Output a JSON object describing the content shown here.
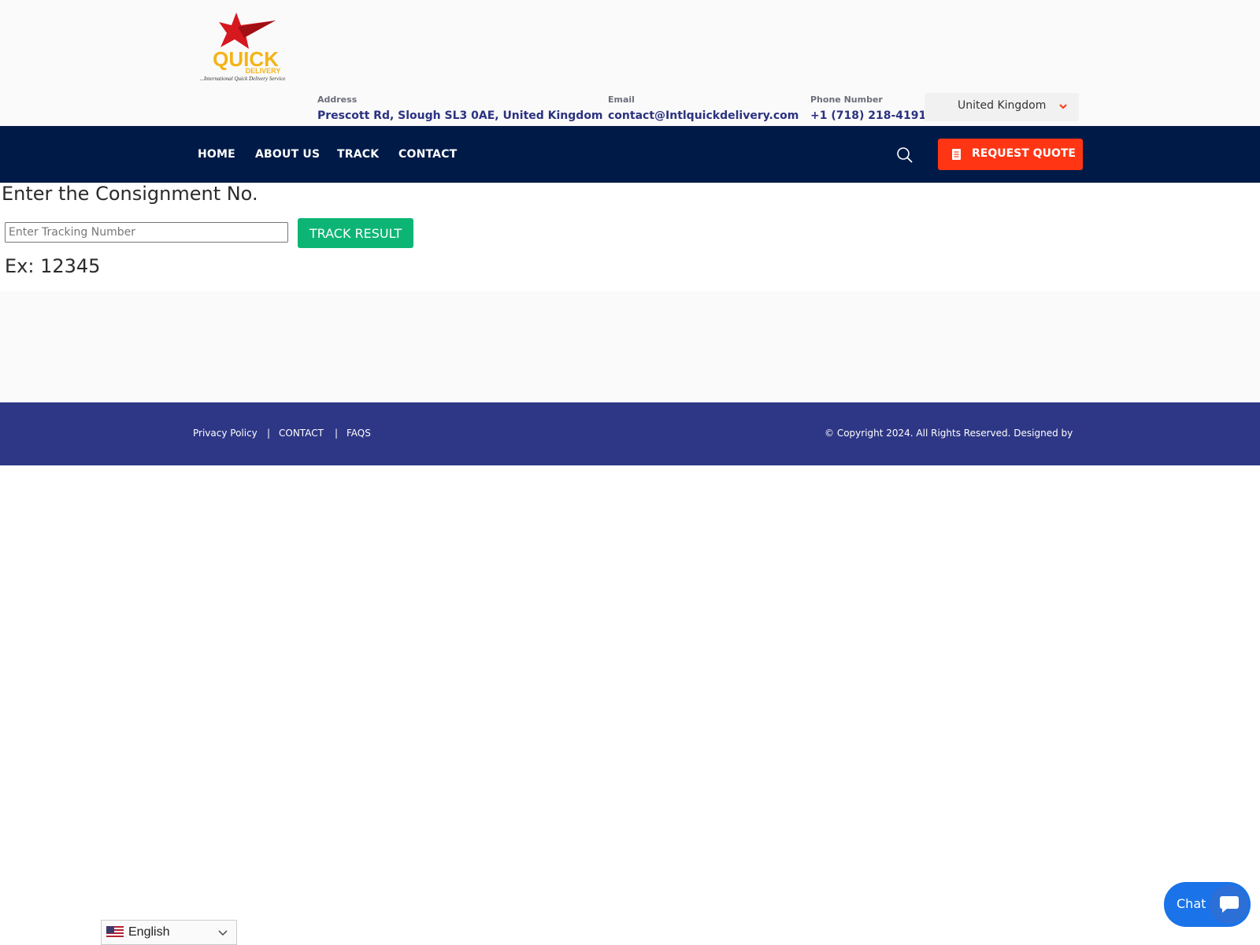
{
  "header": {
    "logo": {
      "brand": "QUICK",
      "sub": "DELIVERY",
      "tagline": "...International Quick Delivery Service"
    },
    "address": {
      "label": "Address",
      "value": "Prescott Rd, Slough SL3 0AE, United Kingdom"
    },
    "email": {
      "label": "Email",
      "value": "contact@Intlquickdelivery.com"
    },
    "phone": {
      "label": "Phone Number",
      "value": "+1 (718) 218-4191"
    },
    "country_select": {
      "value": "United Kingdom"
    }
  },
  "nav": {
    "items": [
      {
        "label": "HOME"
      },
      {
        "label": "ABOUT US"
      },
      {
        "label": "TRACK"
      },
      {
        "label": "CONTACT"
      }
    ],
    "quote_button": "REQUEST QUOTE"
  },
  "tracking": {
    "heading": "Enter the Consignment No.",
    "input_placeholder": "Enter Tracking Number",
    "input_value": "",
    "button": "TRACK RESULT",
    "example": "Ex: 12345"
  },
  "footer": {
    "links": [
      {
        "label": "Privacy Policy"
      },
      {
        "label": "CONTACT"
      },
      {
        "label": "FAQS"
      }
    ],
    "separator": "|",
    "copyright": "© Copyright 2024. All Rights Reserved. Designed by"
  },
  "language": {
    "value": "English"
  },
  "chat": {
    "label": "Chat"
  },
  "colors": {
    "nav_bg": "#001a48",
    "quote_btn": "#ff3514",
    "track_btn": "#0db574",
    "footer_bg": "#2e3785",
    "chat_bg": "#1a73e8",
    "info_value": "#2b3280"
  },
  "icons": [
    "logo",
    "search-icon",
    "document-icon",
    "chevron-down-icon",
    "us-flag-icon",
    "chat-bubble-icon"
  ]
}
